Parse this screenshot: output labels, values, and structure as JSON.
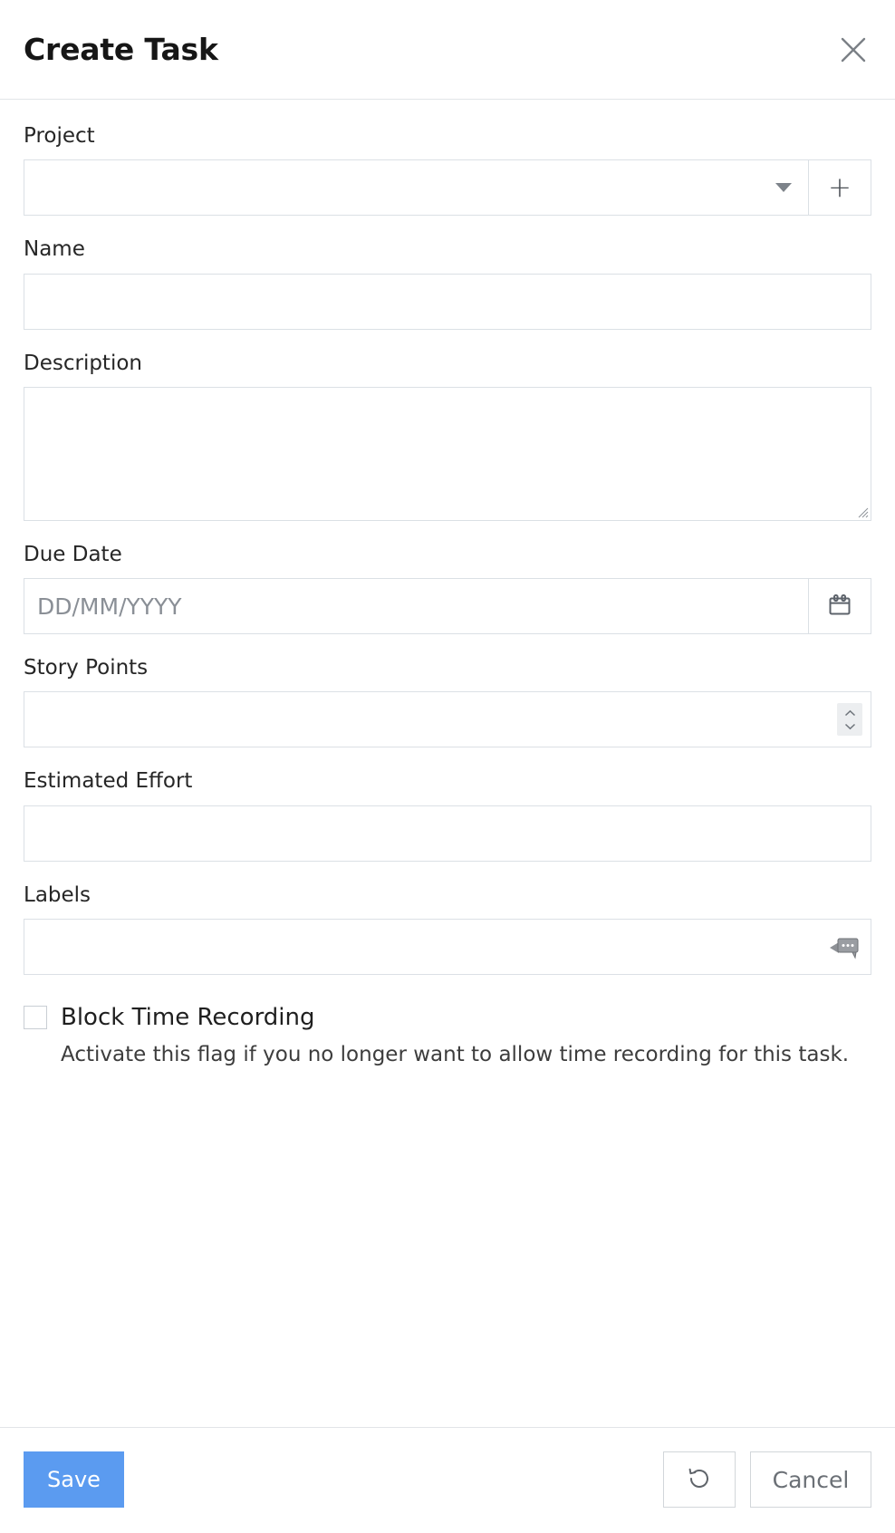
{
  "header": {
    "title": "Create Task",
    "close_icon": "close-icon"
  },
  "form": {
    "project": {
      "label": "Project",
      "value": "",
      "placeholder": "",
      "caret_icon": "chevron-down-icon",
      "add_label": "+"
    },
    "name": {
      "label": "Name",
      "value": "",
      "placeholder": ""
    },
    "description": {
      "label": "Description",
      "value": "",
      "placeholder": ""
    },
    "due_date": {
      "label": "Due Date",
      "value": "",
      "placeholder": "DD/MM/YYYY",
      "calendar_icon": "calendar-icon"
    },
    "story_points": {
      "label": "Story Points",
      "value": "",
      "placeholder": "",
      "spinner_up_icon": "chevron-up-icon",
      "spinner_down_icon": "chevron-down-icon"
    },
    "estimated_effort": {
      "label": "Estimated Effort",
      "value": "",
      "placeholder": ""
    },
    "labels": {
      "label": "Labels",
      "value": "",
      "placeholder": "",
      "bubble_icon": "tooltip-ellipsis-icon"
    },
    "block_time_recording": {
      "label": "Block Time Recording",
      "checked": false,
      "help_text": "Activate this flag if you no longer want to allow time recording for this task."
    }
  },
  "footer": {
    "save_label": "Save",
    "reset_icon": "undo-arrow-icon",
    "cancel_label": "Cancel"
  },
  "colors": {
    "accent": "#5b9bf0",
    "border": "#dbe0e5",
    "text": "#2b2b2b",
    "muted": "#8a8f96"
  }
}
